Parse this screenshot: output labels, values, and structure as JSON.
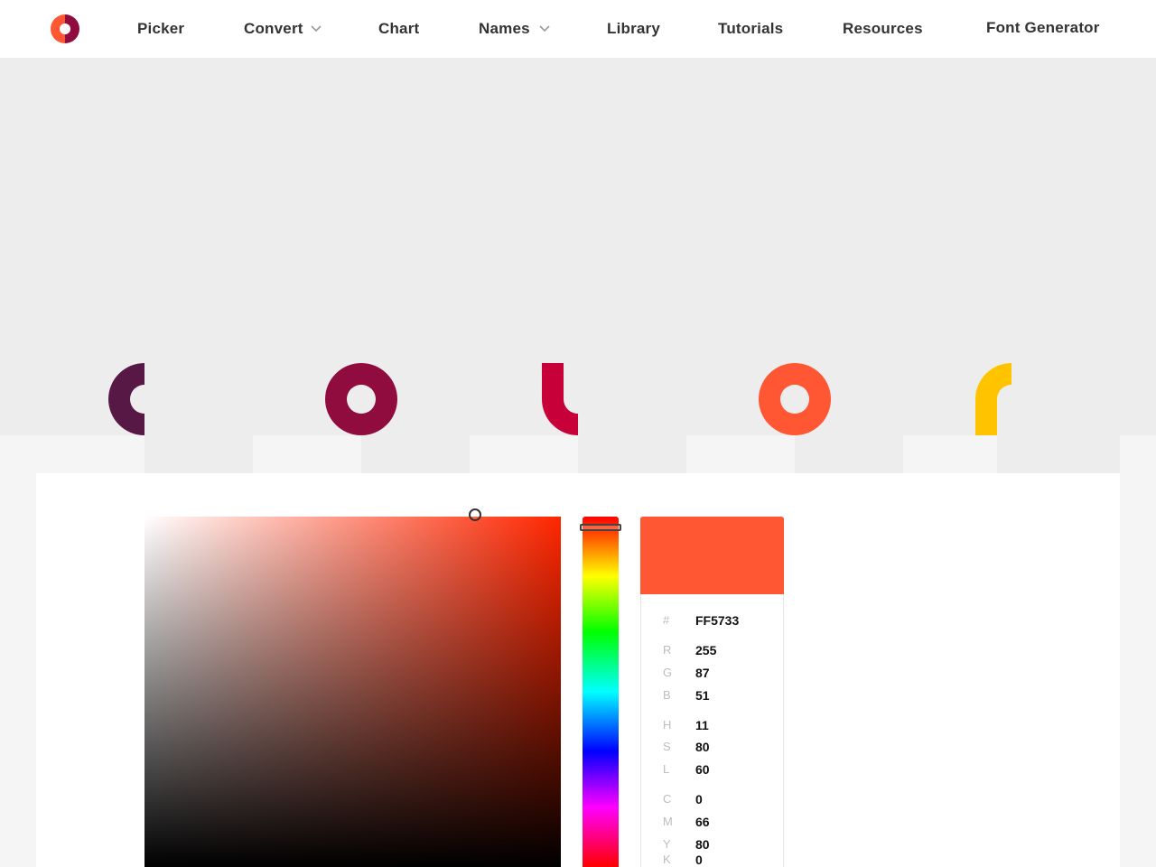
{
  "nav": {
    "logo": "colorcodes-logo",
    "items": [
      {
        "label": "Picker",
        "dropdown": false
      },
      {
        "label": "Convert",
        "dropdown": true
      },
      {
        "label": "Chart",
        "dropdown": false
      },
      {
        "label": "Names",
        "dropdown": true
      },
      {
        "label": "Library",
        "dropdown": false
      },
      {
        "label": "Tutorials",
        "dropdown": false
      },
      {
        "label": "Resources",
        "dropdown": false
      },
      {
        "label": "Font Generator",
        "dropdown": false
      }
    ]
  },
  "hero": {
    "shapes": [
      {
        "name": "half-ring-shape",
        "color": "#581845"
      },
      {
        "name": "ring-shape",
        "color": "#900c3f"
      },
      {
        "name": "hook-shape",
        "color": "#c70039"
      },
      {
        "name": "ring-shape",
        "color": "#ff5733"
      },
      {
        "name": "arch-shape",
        "color": "#ffc300"
      }
    ]
  },
  "picker": {
    "base_hue_color": "#ff2600",
    "selected_color": "#ff5733",
    "hex": {
      "label": "#",
      "value": "FF5733"
    },
    "rgb": [
      {
        "label": "R",
        "value": "255"
      },
      {
        "label": "G",
        "value": "87"
      },
      {
        "label": "B",
        "value": "51"
      }
    ],
    "hsl": [
      {
        "label": "H",
        "value": "11"
      },
      {
        "label": "S",
        "value": "80"
      },
      {
        "label": "L",
        "value": "60"
      }
    ],
    "cmyk": [
      {
        "label": "C",
        "value": "0"
      },
      {
        "label": "M",
        "value": "66"
      },
      {
        "label": "Y",
        "value": "80"
      },
      {
        "label": "K",
        "value": "0"
      }
    ]
  }
}
